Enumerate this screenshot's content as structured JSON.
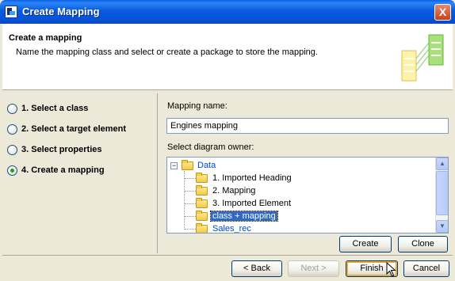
{
  "window": {
    "title": "Create Mapping",
    "close_glyph": "X"
  },
  "header": {
    "title": "Create a mapping",
    "description": "Name the mapping class and select or create a package to store the mapping."
  },
  "steps": [
    {
      "label": "1. Select a class",
      "checked": false
    },
    {
      "label": "2. Select a target element",
      "checked": false
    },
    {
      "label": "3. Select properties",
      "checked": false
    },
    {
      "label": "4. Create a mapping",
      "checked": true
    }
  ],
  "form": {
    "mapping_name_label": "Mapping name:",
    "mapping_name_value": "Engines mapping",
    "owner_label": "Select diagram owner:"
  },
  "tree": {
    "root": {
      "label": "Data",
      "expander": "−"
    },
    "children": [
      {
        "label": "1. Imported Heading",
        "style": "normal"
      },
      {
        "label": "2. Mapping",
        "style": "normal"
      },
      {
        "label": "3. Imported Element",
        "style": "normal"
      },
      {
        "label": "class + mapping",
        "style": "selected"
      },
      {
        "label": "Sales_rec",
        "style": "blue"
      }
    ]
  },
  "tree_buttons": {
    "create": "Create",
    "clone": "Clone"
  },
  "nav_buttons": {
    "back": "< Back",
    "next": "Next >",
    "finish": "Finish",
    "cancel": "Cancel"
  },
  "colors": {
    "titlebar": "#0a5ae0",
    "selection": "#316ac5",
    "link_blue": "#0047c0",
    "radio_dot": "#21a121"
  }
}
